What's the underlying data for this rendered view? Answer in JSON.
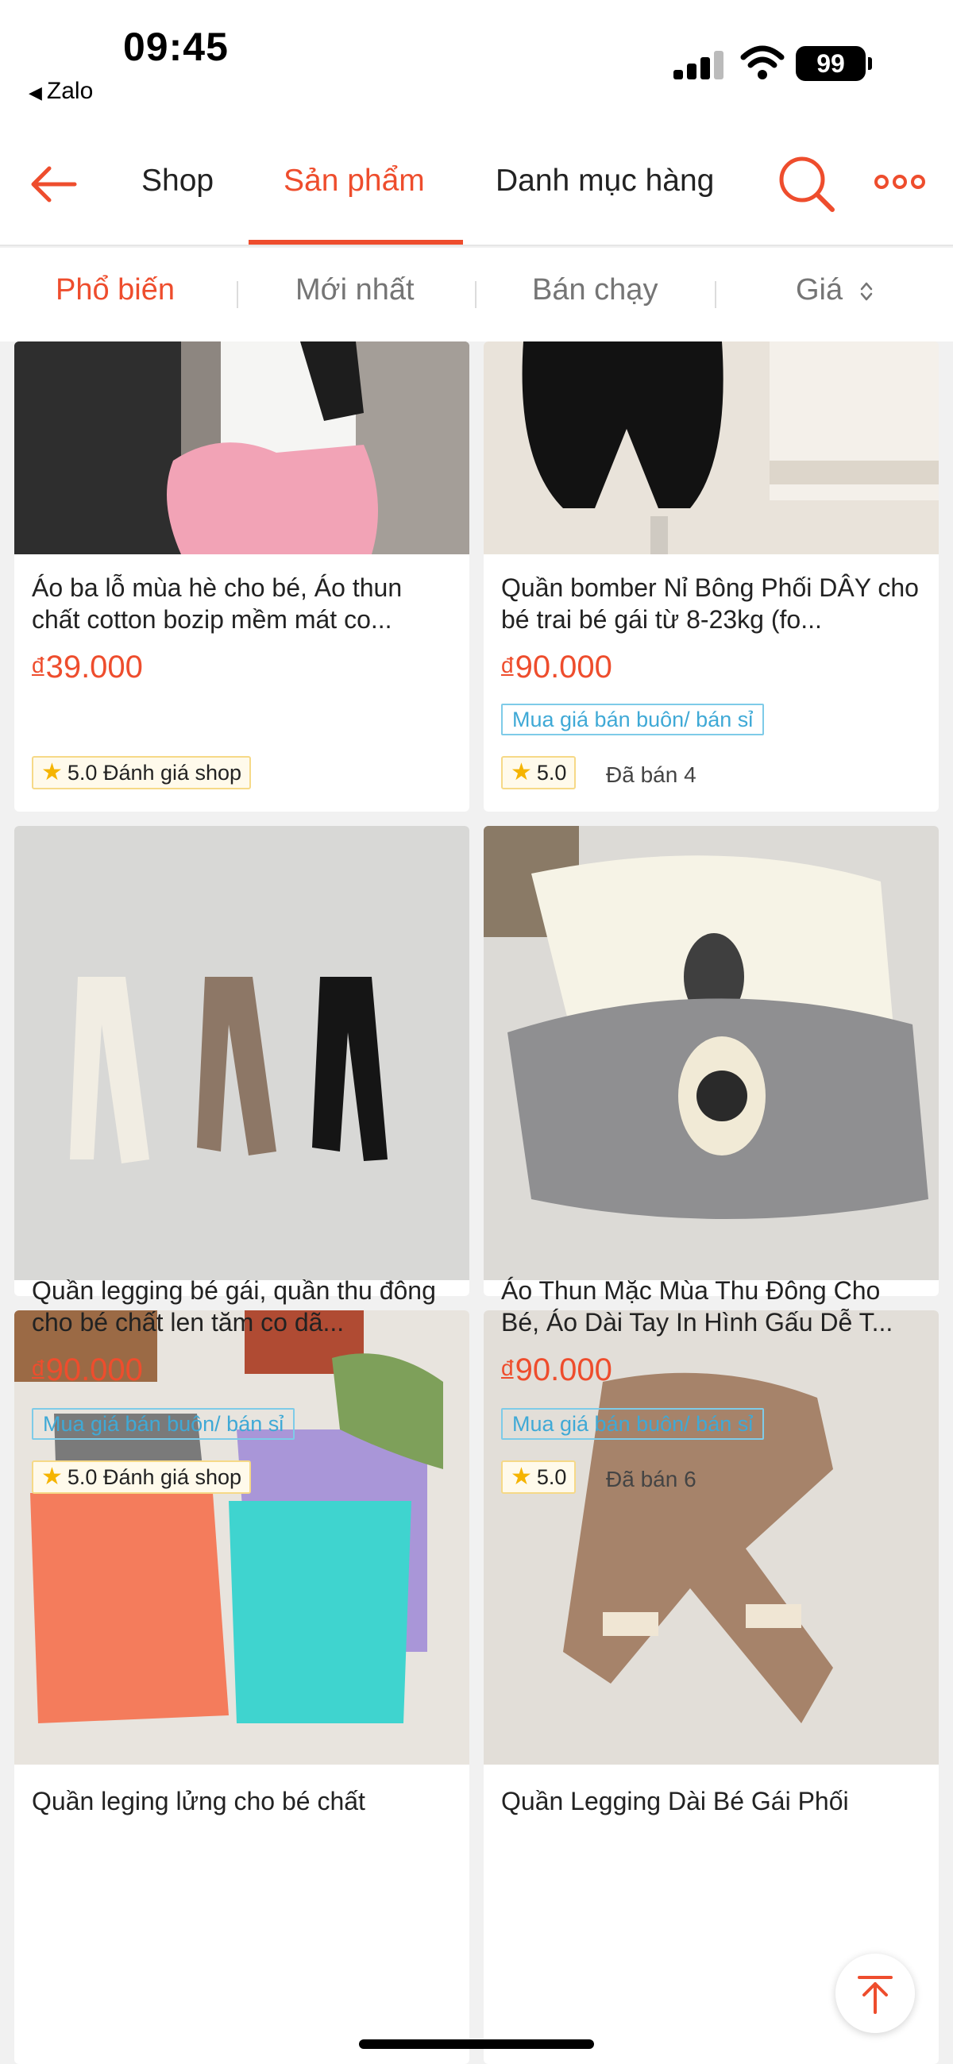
{
  "status_bar": {
    "time": "09:45",
    "back_app": "Zalo",
    "battery": "99"
  },
  "nav": {
    "tabs": [
      "Shop",
      "Sản phẩm",
      "Danh mục hàng"
    ],
    "active_tab": "Sản phẩm"
  },
  "sort": {
    "items": [
      "Phổ biến",
      "Mới nhất",
      "Bán chạy",
      "Giá"
    ],
    "active": "Phổ biến"
  },
  "currency_symbol": "đ",
  "products": [
    {
      "title": "Áo ba lỗ mùa hè cho bé, Áo thun chất cotton bozip mềm mát co...",
      "price": "39.000",
      "wholesale": "",
      "rating": "5.0 Đánh giá shop",
      "sold": ""
    },
    {
      "title": "Quần bomber Nỉ Bông Phối DÂY cho bé trai bé gái từ 8-23kg (fo...",
      "price": "90.000",
      "wholesale": "Mua giá bán buôn/ bán sỉ",
      "rating": "5.0",
      "sold": "Đã bán 4"
    },
    {
      "title": "Quần legging bé gái, quần thu đông cho bé chất len tăm co dã...",
      "price": "90.000",
      "wholesale": "Mua giá bán buôn/ bán sỉ",
      "rating": "5.0 Đánh giá shop",
      "sold": ""
    },
    {
      "title": "Áo Thun Mặc Mùa Thu Đông Cho Bé, Áo Dài Tay In Hình Gấu Dễ T...",
      "price": "90.000",
      "wholesale": "Mua giá bán buôn/ bán sỉ",
      "rating": "5.0",
      "sold": "Đã bán 6"
    },
    {
      "title": "Quần leging lửng cho bé chất",
      "price": "",
      "wholesale": "",
      "rating": "",
      "sold": ""
    },
    {
      "title": "Quần Legging Dài Bé Gái Phối",
      "price": "",
      "wholesale": "",
      "rating": "",
      "sold": ""
    }
  ],
  "colors": {
    "accent": "#ee4d2d",
    "wholesale": "#3fa9d6",
    "star": "#f5b400"
  },
  "icons": [
    "back-arrow-icon",
    "search-icon",
    "more-icon",
    "sort-arrows-icon",
    "star-icon",
    "scroll-top-icon"
  ]
}
